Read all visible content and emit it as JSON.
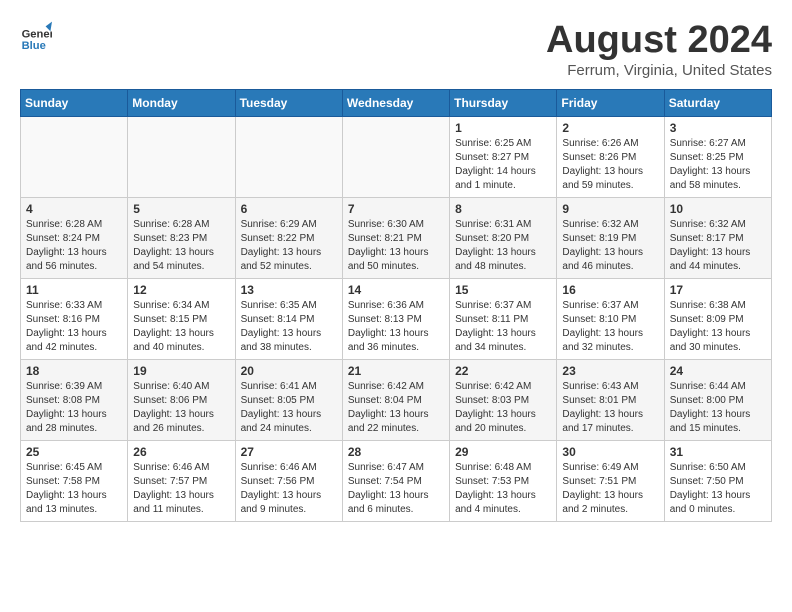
{
  "header": {
    "logo_line1": "General",
    "logo_line2": "Blue",
    "month_year": "August 2024",
    "location": "Ferrum, Virginia, United States"
  },
  "weekdays": [
    "Sunday",
    "Monday",
    "Tuesday",
    "Wednesday",
    "Thursday",
    "Friday",
    "Saturday"
  ],
  "weeks": [
    [
      {
        "day": "",
        "sunrise": "",
        "sunset": "",
        "daylight": ""
      },
      {
        "day": "",
        "sunrise": "",
        "sunset": "",
        "daylight": ""
      },
      {
        "day": "",
        "sunrise": "",
        "sunset": "",
        "daylight": ""
      },
      {
        "day": "",
        "sunrise": "",
        "sunset": "",
        "daylight": ""
      },
      {
        "day": "1",
        "sunrise": "Sunrise: 6:25 AM",
        "sunset": "Sunset: 8:27 PM",
        "daylight": "Daylight: 14 hours and 1 minute."
      },
      {
        "day": "2",
        "sunrise": "Sunrise: 6:26 AM",
        "sunset": "Sunset: 8:26 PM",
        "daylight": "Daylight: 13 hours and 59 minutes."
      },
      {
        "day": "3",
        "sunrise": "Sunrise: 6:27 AM",
        "sunset": "Sunset: 8:25 PM",
        "daylight": "Daylight: 13 hours and 58 minutes."
      }
    ],
    [
      {
        "day": "4",
        "sunrise": "Sunrise: 6:28 AM",
        "sunset": "Sunset: 8:24 PM",
        "daylight": "Daylight: 13 hours and 56 minutes."
      },
      {
        "day": "5",
        "sunrise": "Sunrise: 6:28 AM",
        "sunset": "Sunset: 8:23 PM",
        "daylight": "Daylight: 13 hours and 54 minutes."
      },
      {
        "day": "6",
        "sunrise": "Sunrise: 6:29 AM",
        "sunset": "Sunset: 8:22 PM",
        "daylight": "Daylight: 13 hours and 52 minutes."
      },
      {
        "day": "7",
        "sunrise": "Sunrise: 6:30 AM",
        "sunset": "Sunset: 8:21 PM",
        "daylight": "Daylight: 13 hours and 50 minutes."
      },
      {
        "day": "8",
        "sunrise": "Sunrise: 6:31 AM",
        "sunset": "Sunset: 8:20 PM",
        "daylight": "Daylight: 13 hours and 48 minutes."
      },
      {
        "day": "9",
        "sunrise": "Sunrise: 6:32 AM",
        "sunset": "Sunset: 8:19 PM",
        "daylight": "Daylight: 13 hours and 46 minutes."
      },
      {
        "day": "10",
        "sunrise": "Sunrise: 6:32 AM",
        "sunset": "Sunset: 8:17 PM",
        "daylight": "Daylight: 13 hours and 44 minutes."
      }
    ],
    [
      {
        "day": "11",
        "sunrise": "Sunrise: 6:33 AM",
        "sunset": "Sunset: 8:16 PM",
        "daylight": "Daylight: 13 hours and 42 minutes."
      },
      {
        "day": "12",
        "sunrise": "Sunrise: 6:34 AM",
        "sunset": "Sunset: 8:15 PM",
        "daylight": "Daylight: 13 hours and 40 minutes."
      },
      {
        "day": "13",
        "sunrise": "Sunrise: 6:35 AM",
        "sunset": "Sunset: 8:14 PM",
        "daylight": "Daylight: 13 hours and 38 minutes."
      },
      {
        "day": "14",
        "sunrise": "Sunrise: 6:36 AM",
        "sunset": "Sunset: 8:13 PM",
        "daylight": "Daylight: 13 hours and 36 minutes."
      },
      {
        "day": "15",
        "sunrise": "Sunrise: 6:37 AM",
        "sunset": "Sunset: 8:11 PM",
        "daylight": "Daylight: 13 hours and 34 minutes."
      },
      {
        "day": "16",
        "sunrise": "Sunrise: 6:37 AM",
        "sunset": "Sunset: 8:10 PM",
        "daylight": "Daylight: 13 hours and 32 minutes."
      },
      {
        "day": "17",
        "sunrise": "Sunrise: 6:38 AM",
        "sunset": "Sunset: 8:09 PM",
        "daylight": "Daylight: 13 hours and 30 minutes."
      }
    ],
    [
      {
        "day": "18",
        "sunrise": "Sunrise: 6:39 AM",
        "sunset": "Sunset: 8:08 PM",
        "daylight": "Daylight: 13 hours and 28 minutes."
      },
      {
        "day": "19",
        "sunrise": "Sunrise: 6:40 AM",
        "sunset": "Sunset: 8:06 PM",
        "daylight": "Daylight: 13 hours and 26 minutes."
      },
      {
        "day": "20",
        "sunrise": "Sunrise: 6:41 AM",
        "sunset": "Sunset: 8:05 PM",
        "daylight": "Daylight: 13 hours and 24 minutes."
      },
      {
        "day": "21",
        "sunrise": "Sunrise: 6:42 AM",
        "sunset": "Sunset: 8:04 PM",
        "daylight": "Daylight: 13 hours and 22 minutes."
      },
      {
        "day": "22",
        "sunrise": "Sunrise: 6:42 AM",
        "sunset": "Sunset: 8:03 PM",
        "daylight": "Daylight: 13 hours and 20 minutes."
      },
      {
        "day": "23",
        "sunrise": "Sunrise: 6:43 AM",
        "sunset": "Sunset: 8:01 PM",
        "daylight": "Daylight: 13 hours and 17 minutes."
      },
      {
        "day": "24",
        "sunrise": "Sunrise: 6:44 AM",
        "sunset": "Sunset: 8:00 PM",
        "daylight": "Daylight: 13 hours and 15 minutes."
      }
    ],
    [
      {
        "day": "25",
        "sunrise": "Sunrise: 6:45 AM",
        "sunset": "Sunset: 7:58 PM",
        "daylight": "Daylight: 13 hours and 13 minutes."
      },
      {
        "day": "26",
        "sunrise": "Sunrise: 6:46 AM",
        "sunset": "Sunset: 7:57 PM",
        "daylight": "Daylight: 13 hours and 11 minutes."
      },
      {
        "day": "27",
        "sunrise": "Sunrise: 6:46 AM",
        "sunset": "Sunset: 7:56 PM",
        "daylight": "Daylight: 13 hours and 9 minutes."
      },
      {
        "day": "28",
        "sunrise": "Sunrise: 6:47 AM",
        "sunset": "Sunset: 7:54 PM",
        "daylight": "Daylight: 13 hours and 6 minutes."
      },
      {
        "day": "29",
        "sunrise": "Sunrise: 6:48 AM",
        "sunset": "Sunset: 7:53 PM",
        "daylight": "Daylight: 13 hours and 4 minutes."
      },
      {
        "day": "30",
        "sunrise": "Sunrise: 6:49 AM",
        "sunset": "Sunset: 7:51 PM",
        "daylight": "Daylight: 13 hours and 2 minutes."
      },
      {
        "day": "31",
        "sunrise": "Sunrise: 6:50 AM",
        "sunset": "Sunset: 7:50 PM",
        "daylight": "Daylight: 13 hours and 0 minutes."
      }
    ]
  ]
}
